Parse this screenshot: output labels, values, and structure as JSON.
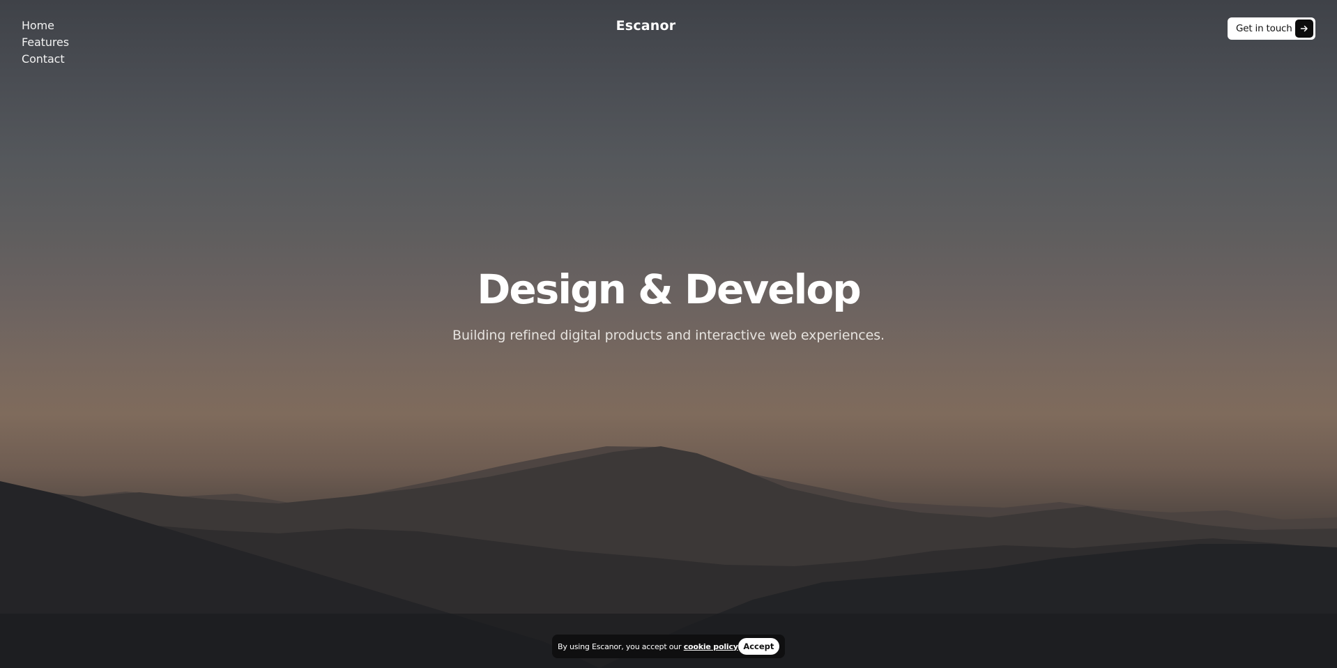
{
  "brand": "Escanor",
  "nav": {
    "items": [
      {
        "label": "Home"
      },
      {
        "label": "Features"
      },
      {
        "label": "Contact"
      }
    ]
  },
  "cta": {
    "label": "Get in touch",
    "icon": "arrow-right-icon"
  },
  "hero": {
    "title": "Design & Develop",
    "subtitle": "Building refined digital products and interactive web experiences."
  },
  "cookie": {
    "text": "By using Escanor, you accept our ",
    "link_label": "cookie policy",
    "accept_label": "Accept"
  },
  "colors": {
    "cta_bg": "#ffffff",
    "cta_icon_bg": "#0c0c0c",
    "banner_bg": "#0f0f10",
    "text": "#ffffff"
  }
}
